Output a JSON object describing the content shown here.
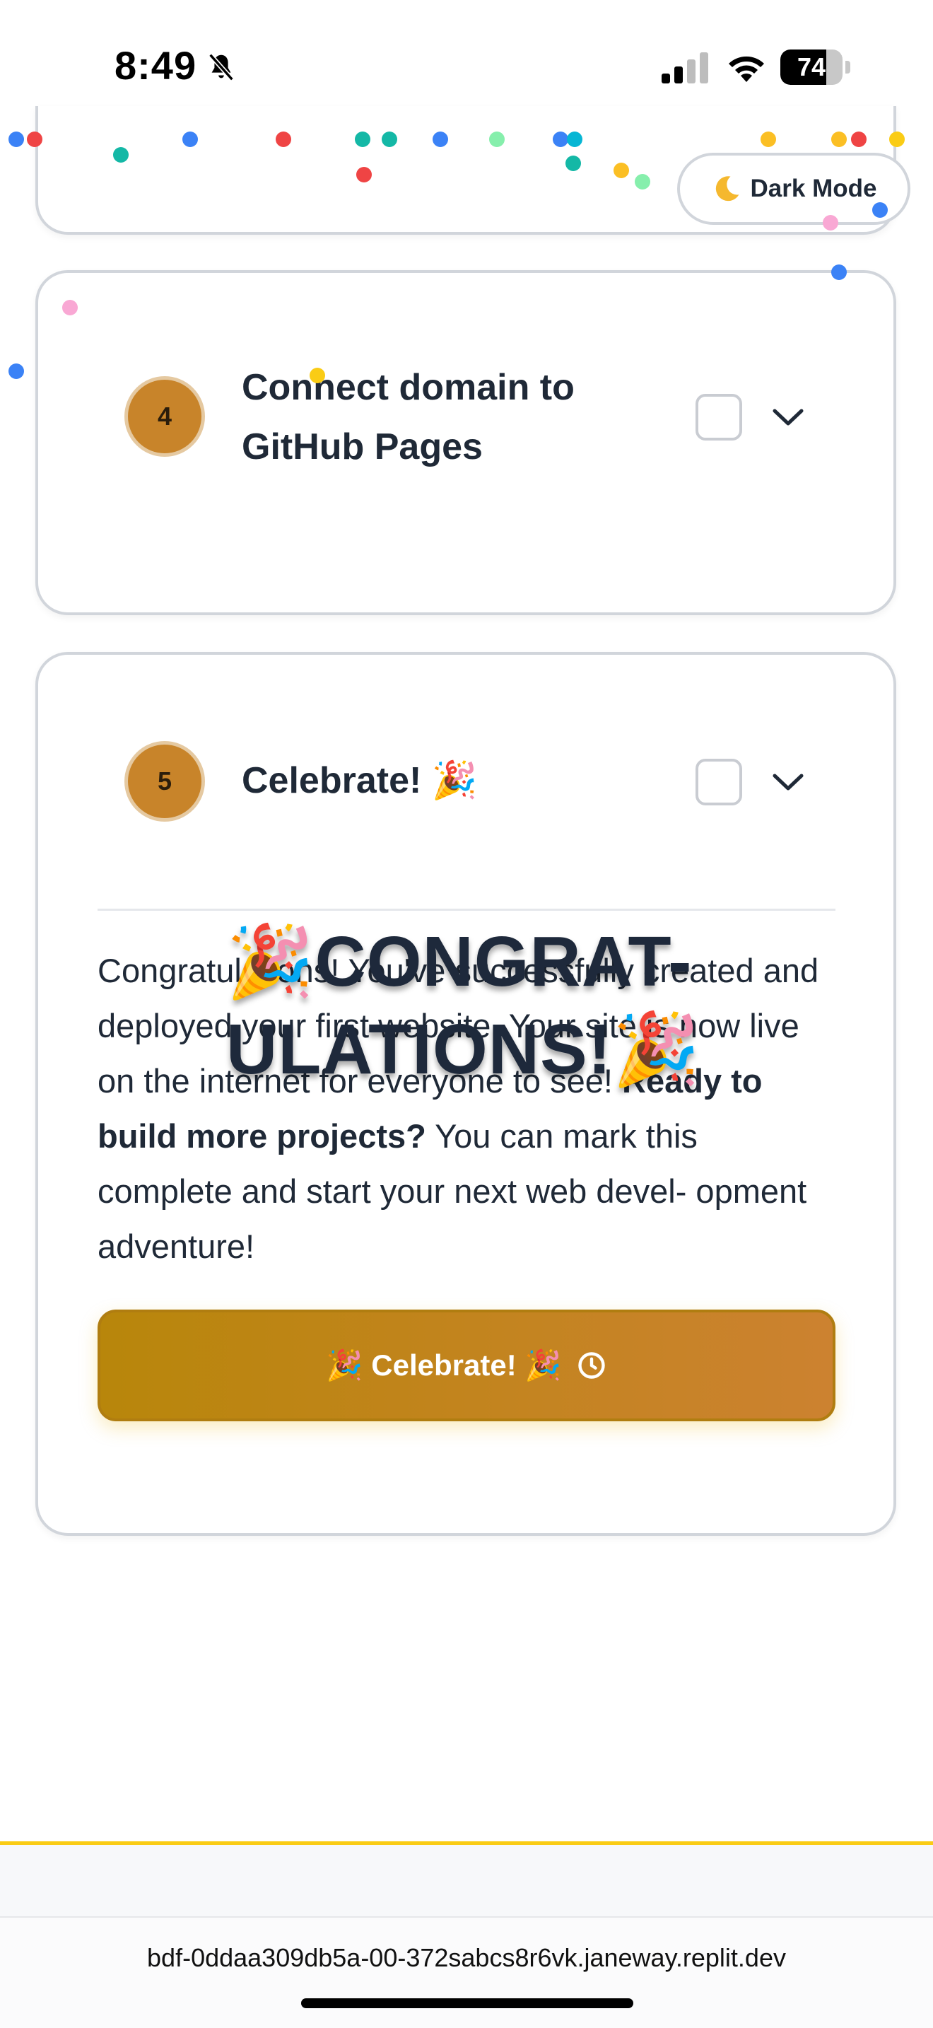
{
  "status_bar": {
    "time": "8:49",
    "battery": "74",
    "battery_level": 0.74
  },
  "header": {
    "dark_mode_label": "Dark Mode"
  },
  "steps": [
    {
      "number": "4",
      "title_line1": "Connect domain to",
      "title_line2": "GitHub Pages"
    },
    {
      "number": "5",
      "title": "Celebrate! 🎉"
    }
  ],
  "step5_body": {
    "paragraph": "Congratulations! You've successfully created and deployed your first website. Your site is now live on the internet for everyone to see!",
    "bold": "Ready to build more projects?",
    "rest": "You can mark this complete and start your next web devel- opment adventure!"
  },
  "celebrate_button": {
    "label": "🎉 Celebrate! 🎉"
  },
  "overlay": {
    "line1": "🎉CONGRAT-",
    "line2": "ULATIONS!🎉"
  },
  "browser": {
    "url": "bdf-0ddaa309db5a-00-372sabcs8r6vk.janeway.replit.dev"
  },
  "colors": {
    "accent": "#c8842a",
    "button_start": "#b8860b",
    "button_end": "#cc8230",
    "confetti": [
      "#ef4444",
      "#3b82f6",
      "#14b8a6",
      "#fbbf24",
      "#86efac",
      "#f9a8d4",
      "#facc15",
      "#06b6d4"
    ]
  }
}
